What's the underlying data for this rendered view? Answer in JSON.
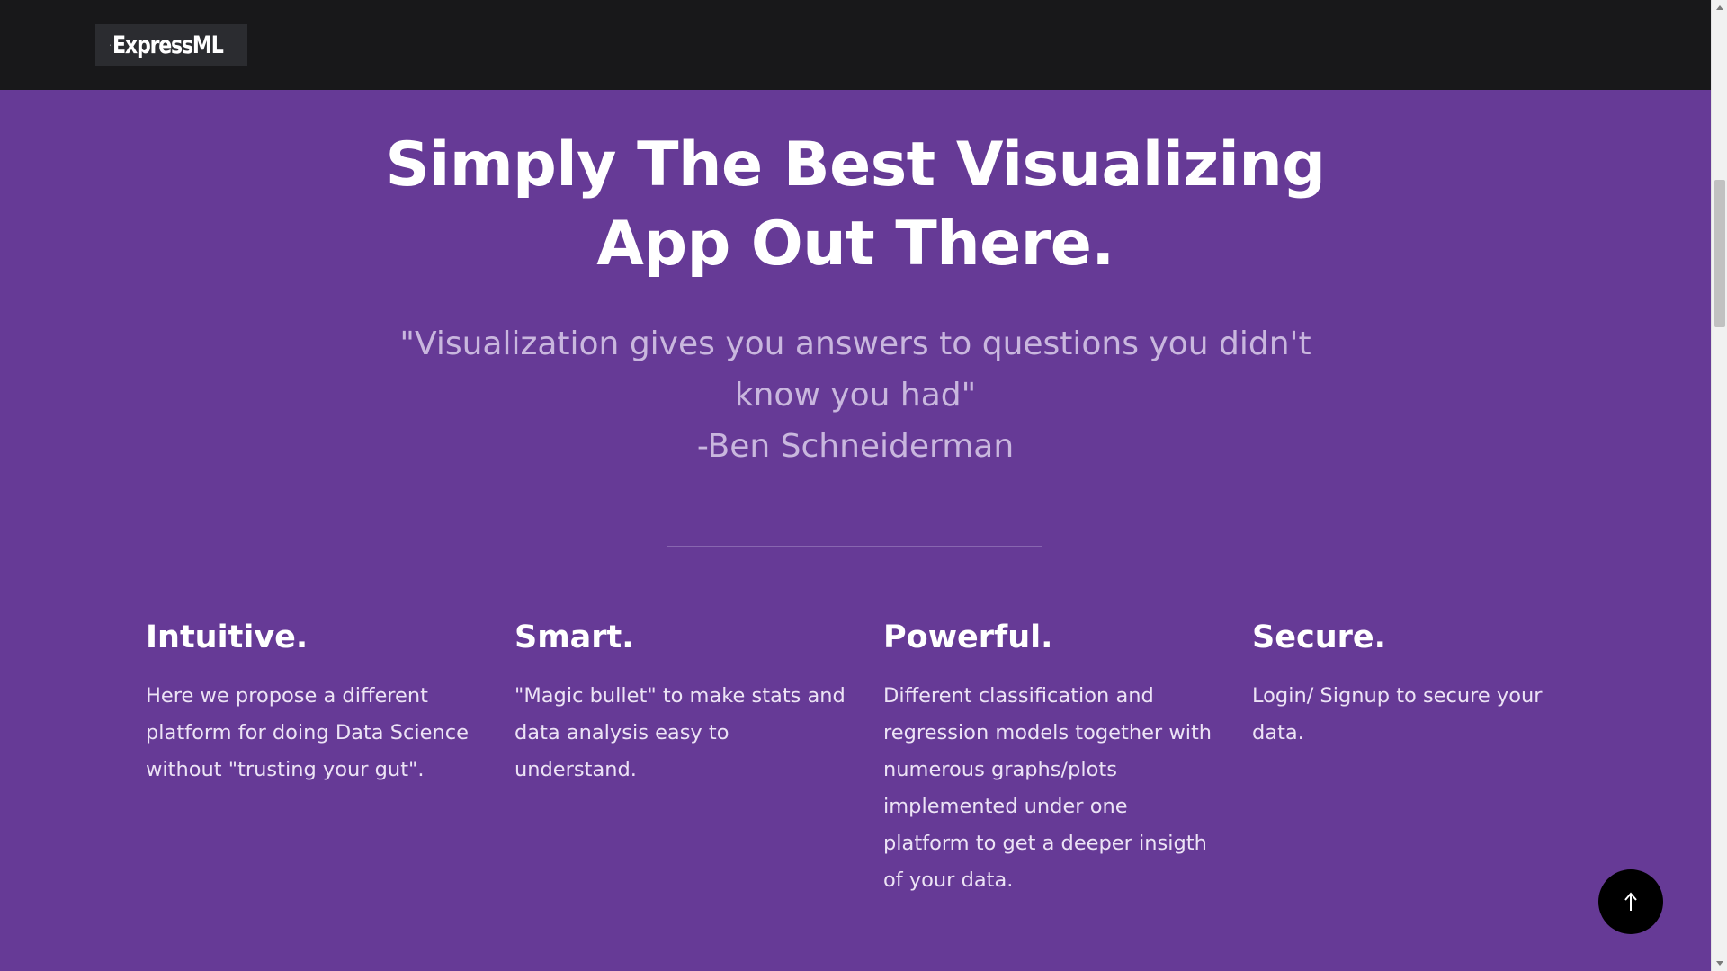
{
  "header": {
    "logo_text": "ExpressML"
  },
  "hero": {
    "title_line1": "Simply The Best Visualizing",
    "title_line2": "App Out There.",
    "quote_line1": "\"Visualization gives you answers to questions you didn't",
    "quote_line2": "know you had\"",
    "quote_author": "-Ben Schneiderman"
  },
  "features": [
    {
      "title": "Intuitive.",
      "text": "Here we propose a different platform for doing Data Science without \"trusting your gut\"."
    },
    {
      "title": "Smart.",
      "text": "\"Magic bullet\" to make stats and data analysis easy to understand."
    },
    {
      "title": "Powerful.",
      "text": "Different classification and regression models together with numerous graphs/plots implemented under one platform to get a deeper insigth of your data."
    },
    {
      "title": "Secure.",
      "text": "Login/ Signup to secure your data."
    }
  ],
  "colors": {
    "background": "#663a96",
    "topbar": "#18181a",
    "quote": "#c9b7de",
    "back_to_top": "#000000"
  },
  "icons": {
    "back_to_top": "arrow-up-icon",
    "logo": "pyramid-logo-icon"
  }
}
